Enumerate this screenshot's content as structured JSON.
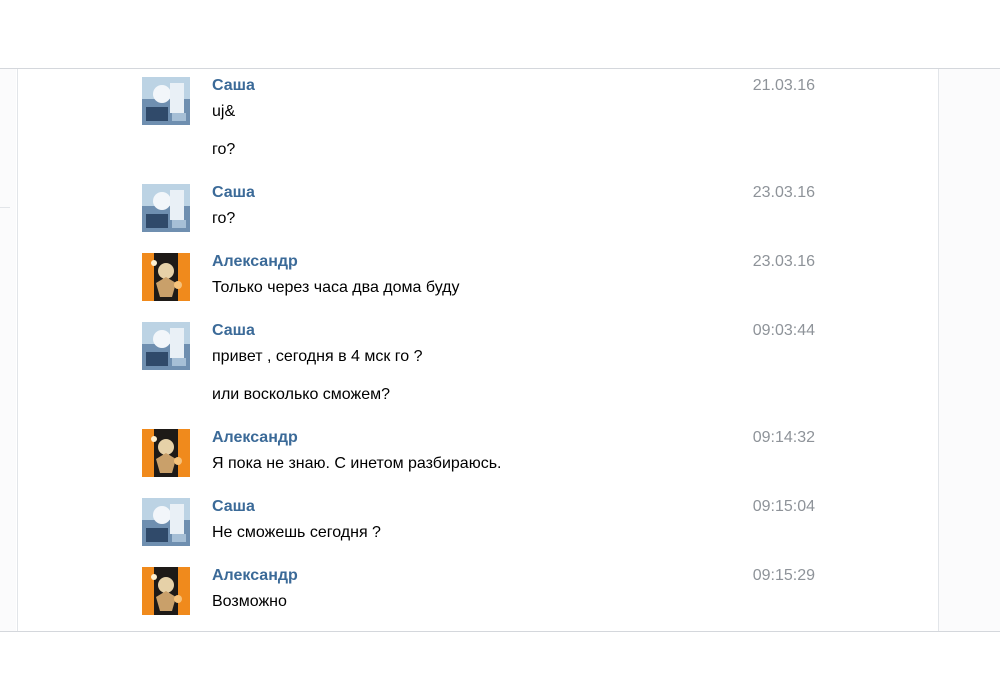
{
  "messages": [
    {
      "author": "Саша",
      "date": "21.03.16",
      "avatar": "sasha-avatar",
      "lines": [
        "uj&",
        "го?"
      ]
    },
    {
      "author": "Саша",
      "date": "23.03.16",
      "avatar": "sasha-avatar",
      "lines": [
        "го?"
      ]
    },
    {
      "author": "Александр",
      "date": "23.03.16",
      "avatar": "alexandr-avatar",
      "lines": [
        "Только через часа два дома буду"
      ]
    },
    {
      "author": "Саша",
      "date": "09:03:44",
      "avatar": "sasha-avatar",
      "lines": [
        "привет , сегодня в 4 мск го ?",
        "или восколько сможем?"
      ]
    },
    {
      "author": "Александр",
      "date": "09:14:32",
      "avatar": "alexandr-avatar",
      "lines": [
        "Я пока не знаю. С инетом разбираюсь."
      ]
    },
    {
      "author": "Саша",
      "date": "09:15:04",
      "avatar": "sasha-avatar",
      "lines": [
        "Не сможешь сегодня ?"
      ]
    },
    {
      "author": "Александр",
      "date": "09:15:29",
      "avatar": "alexandr-avatar",
      "lines": [
        "Возможно"
      ]
    }
  ],
  "colors": {
    "author": "#3b6a98",
    "date": "#8e9399",
    "border": "#d4d7dc"
  }
}
